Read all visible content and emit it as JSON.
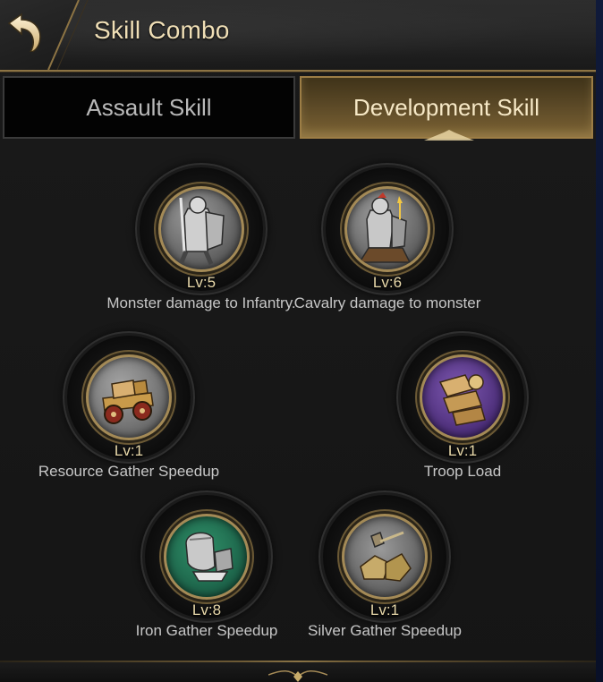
{
  "header": {
    "title": "Skill Combo",
    "back_icon": "back-arrow-icon"
  },
  "tabs": [
    {
      "label": "Assault Skill",
      "active": false
    },
    {
      "label": "Development Skill",
      "active": true
    }
  ],
  "skills": [
    {
      "level": "Lv:5",
      "name": "Monster damage to Infantry.",
      "icon": "infantry-knight-icon",
      "icon_bg": "#6a6a6a"
    },
    {
      "level": "Lv:6",
      "name": "Cavalry damage to monster",
      "icon": "cavalry-knight-icon",
      "icon_bg": "#6e6e6e"
    },
    {
      "level": "Lv:1",
      "name": "Resource Gather Speedup",
      "icon": "resource-cart-icon",
      "icon_bg": "#7a7a7a"
    },
    {
      "level": "Lv:1",
      "name": "Troop Load",
      "icon": "troop-load-icon",
      "icon_bg": "#5a3a86"
    },
    {
      "level": "Lv:8",
      "name": "Iron Gather Speedup",
      "icon": "iron-ore-icon",
      "icon_bg": "#1f6f52"
    },
    {
      "level": "Lv:1",
      "name": "Silver Gather Speedup",
      "icon": "silver-ore-icon",
      "icon_bg": "#6c6c6c"
    }
  ],
  "colors": {
    "accent_gold": "#a48a56",
    "active_tab": "#5a4826",
    "title_text": "#f0dfb6",
    "level_text": "#e9d9aa"
  }
}
